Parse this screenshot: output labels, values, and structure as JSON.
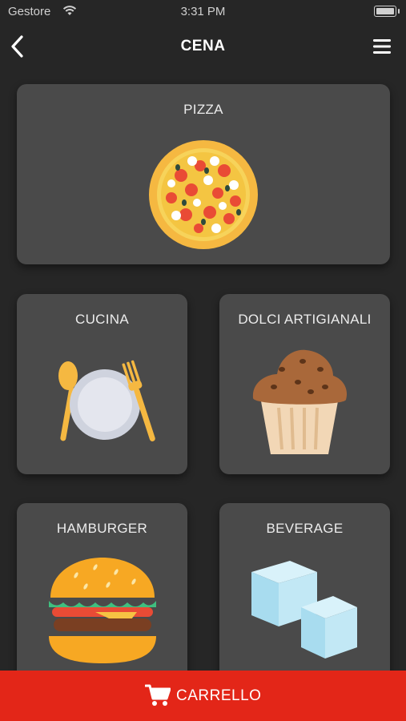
{
  "status_bar": {
    "carrier": "Gestore",
    "time": "3:31 PM"
  },
  "header": {
    "title": "CENA",
    "back_icon": "chevron-left-icon",
    "menu_icon": "hamburger-menu-icon"
  },
  "categories": [
    {
      "label": "PIZZA",
      "icon": "pizza-icon"
    },
    {
      "label": "CUCINA",
      "icon": "plate-cutlery-icon"
    },
    {
      "label": "DOLCI ARTIGIANALI",
      "icon": "muffin-icon"
    },
    {
      "label": "HAMBURGER",
      "icon": "hamburger-icon"
    },
    {
      "label": "BEVERAGE",
      "icon": "ice-cubes-icon"
    }
  ],
  "cart": {
    "label": "CARRELLO",
    "icon": "cart-icon"
  },
  "colors": {
    "background": "#262626",
    "card": "#4a4a4a",
    "accent": "#e32618"
  }
}
